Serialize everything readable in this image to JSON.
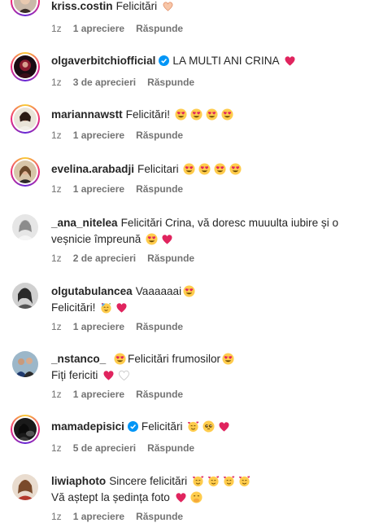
{
  "comments": [
    {
      "username": "kriss.costin",
      "verified": false,
      "lines": [
        "Felicitări"
      ],
      "time": "1z",
      "likes": "1 apreciere",
      "reply": "Răspunde"
    },
    {
      "username": "olgaverbitchiofficial",
      "verified": true,
      "lines": [
        "LA MULTI ANI CRINA"
      ],
      "time": "1z",
      "likes": "3 de aprecieri",
      "reply": "Răspunde"
    },
    {
      "username": "mariannawstt",
      "verified": false,
      "lines": [
        "Felicitări!"
      ],
      "time": "1z",
      "likes": "1 apreciere",
      "reply": "Răspunde"
    },
    {
      "username": "evelina.arabadji",
      "verified": false,
      "lines": [
        "Felicitari"
      ],
      "time": "1z",
      "likes": "1 apreciere",
      "reply": "Răspunde"
    },
    {
      "username": "_ana_nitelea",
      "verified": false,
      "lines": [
        "Felicitări Crina, vă doresc muuulta iubire și o",
        "veșnicie împreună"
      ],
      "time": "1z",
      "likes": "2 de aprecieri",
      "reply": "Răspunde"
    },
    {
      "username": "olgutabulancea",
      "verified": false,
      "lines": [
        "Vaaaaaai",
        "Felicitări!"
      ],
      "time": "1z",
      "likes": "1 apreciere",
      "reply": "Răspunde"
    },
    {
      "username": "_nstanco_",
      "verified": false,
      "lines": [
        "Felicitări frumosilor",
        "Fiți fericiti"
      ],
      "time": "1z",
      "likes": "1 apreciere",
      "reply": "Răspunde"
    },
    {
      "username": "mamadepisici",
      "verified": true,
      "lines": [
        "Felicitări"
      ],
      "time": "1z",
      "likes": "5 de aprecieri",
      "reply": "Răspunde"
    },
    {
      "username": "liwiaphoto",
      "verified": false,
      "lines": [
        "Sincere felicitări",
        "Vă aștept la ședința foto"
      ],
      "time": "1z",
      "likes": "1 apreciere",
      "reply": "Răspunde"
    }
  ],
  "colors": {
    "text": "#262626",
    "meta": "#737373",
    "verified": "#0095f6",
    "heart": "#e0245e"
  }
}
